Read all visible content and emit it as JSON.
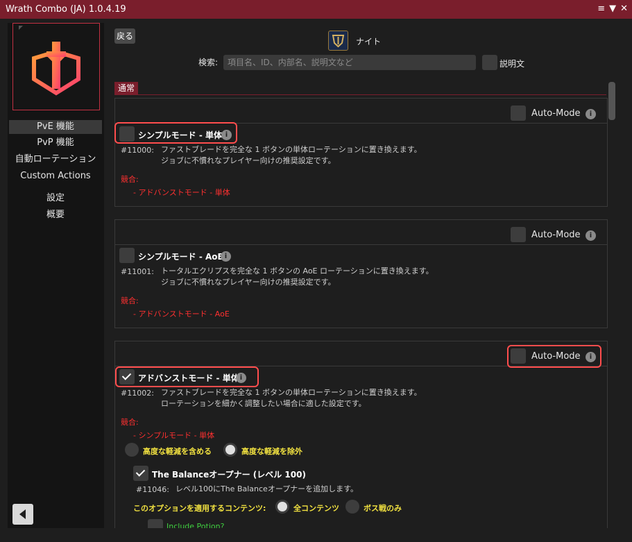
{
  "window": {
    "title": "Wrath Combo (JA) 1.0.4.19",
    "controls": [
      "≡",
      "▼",
      "✕"
    ]
  },
  "sidebar": {
    "items": [
      {
        "label": "PvE 機能",
        "active": true
      },
      {
        "label": "PvP 機能"
      },
      {
        "label": "自動ローテーション"
      },
      {
        "label": "Custom Actions"
      },
      {
        "label": "設定"
      },
      {
        "label": "概要"
      }
    ]
  },
  "header": {
    "back_label": "戻る",
    "job_name": "ナイト",
    "search_label": "検索:",
    "search_placeholder": "項目名、ID、内部名、説明文など",
    "desc_toggle_label": "説明文"
  },
  "tab": {
    "label": "通常"
  },
  "automode_label": "Auto-Mode",
  "conflict_label": "競合:",
  "features": [
    {
      "name": "シンプルモード - 単体",
      "id": "#11000:",
      "desc1": "ファストブレードを完全な 1 ボタンの単体ローテーションに置き換えます。",
      "desc2": "ジョブに不慣れなプレイヤー向けの推奨設定です。",
      "conflict": "- アドバンストモード - 単体"
    },
    {
      "name": "シンプルモード - AoE",
      "id": "#11001:",
      "desc1": "トータルエクリプスを完全な 1 ボタンの AoE ローテーションに置き換えます。",
      "desc2": "ジョブに不慣れなプレイヤー向けの推奨設定です。",
      "conflict": "- アドバンストモード - AoE"
    },
    {
      "name": "アドバンストモード - 単体",
      "id": "#11002:",
      "desc1": "ファストブレードを完全な 1 ボタンの単体ローテーションに置き換えます。",
      "desc2": "ローテーションを細かく調整したい場合に適した設定です。",
      "conflict": "- シンプルモード - 単体"
    }
  ],
  "options": {
    "mitigation_include": "高度な軽減を含める",
    "mitigation_exclude": "高度な軽減を除外",
    "balance_name": "The Balanceオープナー (レベル 100)",
    "balance_id": "#11046:",
    "balance_desc": "レベル100にThe Balanceオープナーを追加します。",
    "content_label": "このオプションを適用するコンテンツ:",
    "all_content": "全コンテンツ",
    "boss_only": "ボス戦のみ",
    "potion": "Include Potion?"
  },
  "colors": {
    "titlebar": "#7a1e2c",
    "highlight": "#ff4d4d",
    "conflict": "#ff3030",
    "yellow": "#f0e040",
    "green": "#40d040"
  }
}
